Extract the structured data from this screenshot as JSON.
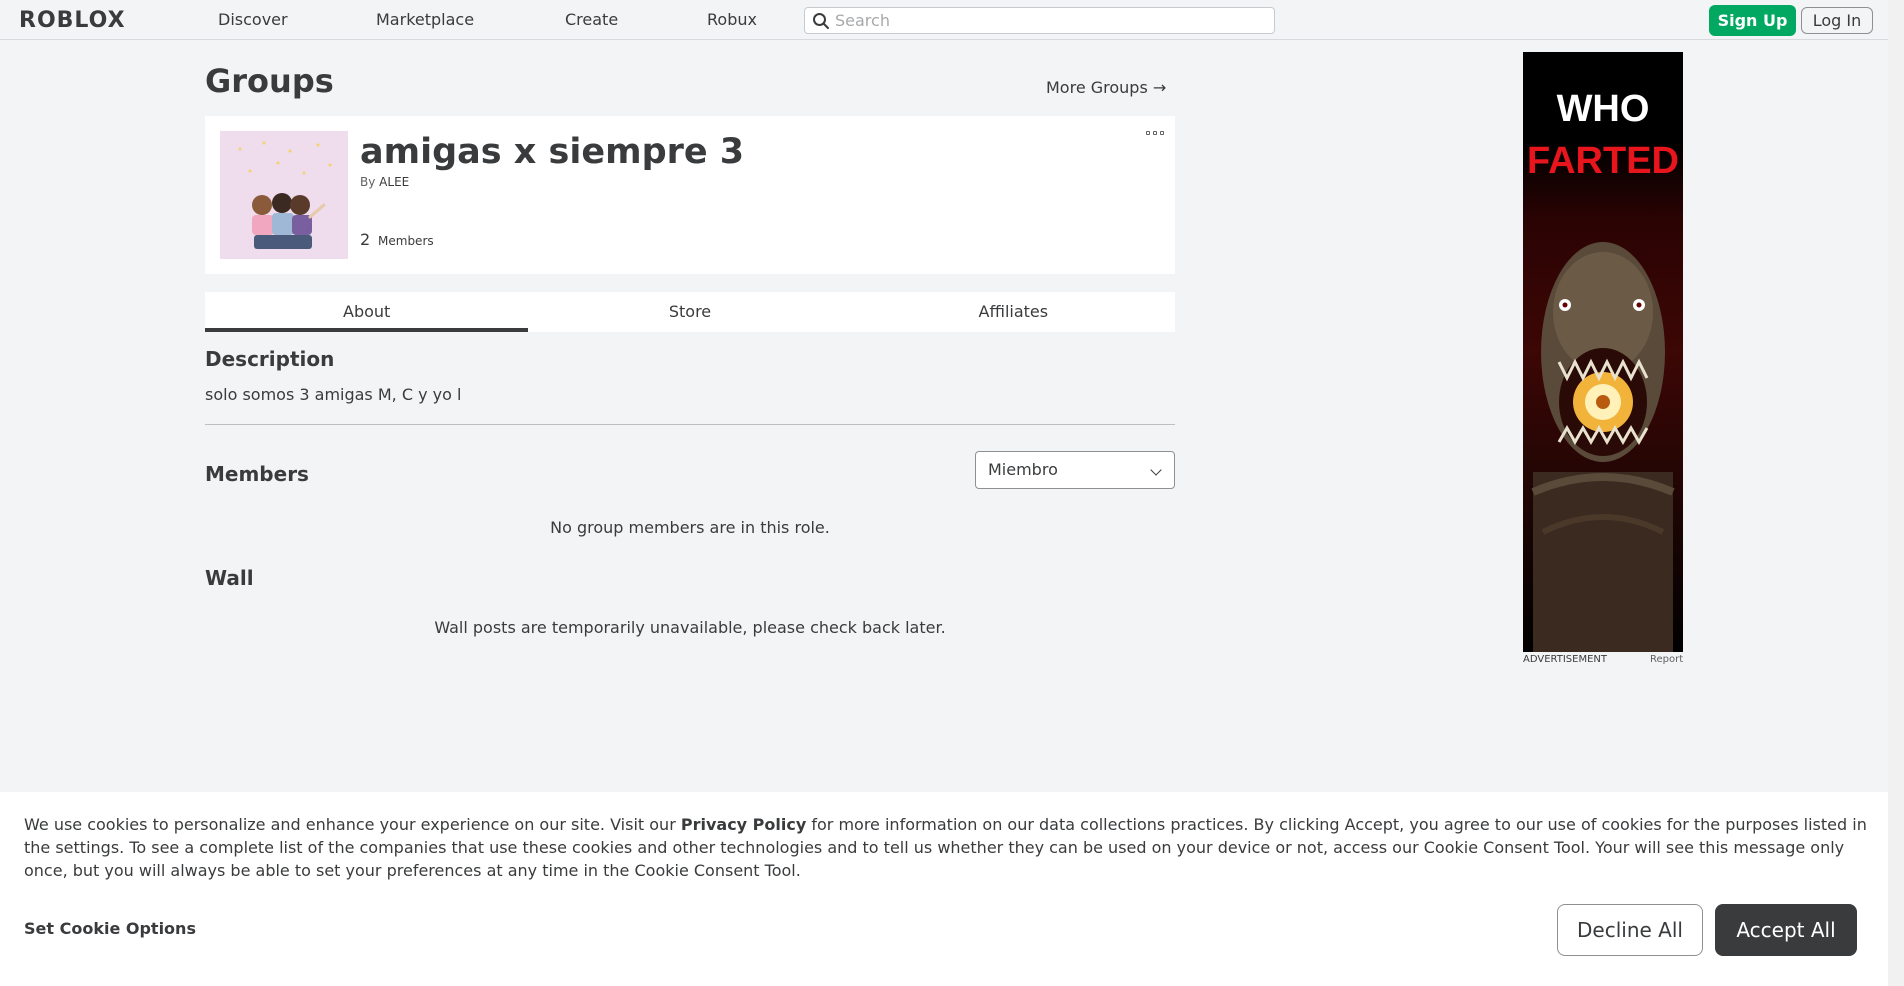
{
  "nav": {
    "logo": "ROBLOX",
    "links": [
      "Discover",
      "Marketplace",
      "Create",
      "Robux"
    ],
    "search_placeholder": "Search",
    "signup_label": "Sign Up",
    "login_label": "Log In"
  },
  "page": {
    "title": "Groups",
    "more_groups": "More Groups →"
  },
  "group": {
    "name": "amigas x siempre 3",
    "by_label": "By",
    "owner": "ALEE",
    "member_count": "2",
    "members_label": "Members"
  },
  "tabs": [
    "About",
    "Store",
    "Affiliates"
  ],
  "about": {
    "description_heading": "Description",
    "description": "solo somos 3 amigas M, C y yo l",
    "members_heading": "Members",
    "role_selected": "Miembro",
    "no_members_msg": "No group members are in this role.",
    "wall_heading": "Wall",
    "wall_msg": "Wall posts are temporarily unavailable, please check back later."
  },
  "ad": {
    "line1": "WHO",
    "line2": "FARTED",
    "label": "ADVERTISEMENT",
    "report": "Report"
  },
  "cookie": {
    "text_before": "We use cookies to personalize and enhance your experience on our site. Visit our ",
    "privacy_link": "Privacy Policy",
    "text_after": " for more information on our data collections practices. By clicking Accept, you agree to our use of cookies for the purposes listed in the settings. To see a complete list of the companies that use these cookies and other technologies and to tell us whether they can be used on your device or not, access our Cookie Consent Tool. Your will see this message only once, but you will always be able to set your preferences at any time in the Cookie Consent Tool.",
    "options_label": "Set Cookie Options",
    "decline_label": "Decline All",
    "accept_label": "Accept All"
  }
}
